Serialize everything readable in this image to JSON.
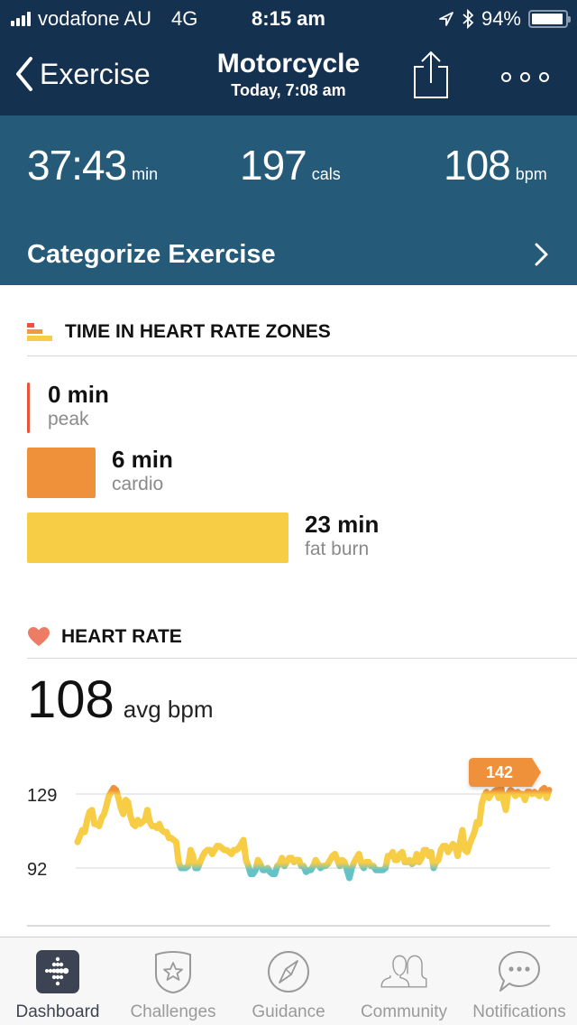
{
  "status_bar": {
    "carrier": "vodafone AU",
    "network": "4G",
    "time": "8:15 am",
    "battery_percent": "94%",
    "battery_level": 0.94,
    "icons": [
      "signal-icon",
      "location-arrow-icon",
      "bluetooth-icon",
      "battery-icon"
    ]
  },
  "nav": {
    "back_label": "Exercise",
    "title": "Motorcycle",
    "subtitle": "Today, 7:08 am",
    "share_icon": "share-icon",
    "more_icon": "more-icon"
  },
  "summary": {
    "duration": {
      "value": "37:43",
      "unit": "min"
    },
    "calories": {
      "value": "197",
      "unit": "cals"
    },
    "heart_rate": {
      "value": "108",
      "unit": "bpm"
    },
    "categorize_label": "Categorize Exercise"
  },
  "zones": {
    "title": "TIME IN HEART RATE ZONES",
    "items": [
      {
        "amount": "0 min",
        "name": "peak",
        "minutes": 0,
        "color": "#e8533a"
      },
      {
        "amount": "6 min",
        "name": "cardio",
        "minutes": 6,
        "color": "#ef913b"
      },
      {
        "amount": "23 min",
        "name": "fat burn",
        "minutes": 23,
        "color": "#f7cd45"
      }
    ]
  },
  "heart_rate": {
    "title": "HEART RATE",
    "avg_value": "108",
    "avg_unit": "avg bpm",
    "heart_color": "#ec7c64"
  },
  "chart_data": {
    "type": "line",
    "title": "HEART RATE",
    "xlabel": "",
    "ylabel": "bpm",
    "y_ticks": [
      129,
      92
    ],
    "ylim": [
      70,
      150
    ],
    "grid": true,
    "max_marker": {
      "label": "142",
      "value": 142,
      "color": "#ef913b"
    },
    "zone_colors": {
      "below_zone": "#64c3c8",
      "fat_burn": "#f7cd45",
      "cardio": "#ef913b"
    },
    "series": [
      {
        "name": "heart rate",
        "values": [
          105,
          108,
          111,
          110,
          116,
          120,
          121,
          114,
          114,
          113,
          117,
          119,
          123,
          128,
          130,
          132,
          131,
          127,
          122,
          119,
          126,
          125,
          118,
          114,
          113,
          116,
          114,
          115,
          116,
          121,
          115,
          113,
          113,
          112,
          114,
          111,
          110,
          110,
          107,
          107,
          106,
          105,
          95,
          92,
          92,
          92,
          93,
          101,
          98,
          92,
          92,
          95,
          98,
          100,
          101,
          101,
          99,
          101,
          103,
          103,
          102,
          101,
          101,
          100,
          99,
          101,
          101,
          102,
          104,
          106,
          96,
          93,
          89,
          89,
          91,
          96,
          94,
          91,
          91,
          92,
          90,
          89,
          89,
          93,
          94,
          97,
          93,
          95,
          97,
          97,
          95,
          96,
          96,
          93,
          93,
          90,
          91,
          91,
          93,
          96,
          94,
          92,
          93,
          93,
          94,
          96,
          98,
          99,
          96,
          93,
          96,
          95,
          91,
          87,
          92,
          95,
          97,
          99,
          94,
          92,
          95,
          95,
          93,
          93,
          91,
          91,
          91,
          91,
          92,
          98,
          98,
          100,
          96,
          96,
          99,
          100,
          95,
          95,
          96,
          94,
          95,
          99,
          95,
          97,
          101,
          101,
          98,
          100,
          92,
          95,
          96,
          101,
          103,
          103,
          100,
          102,
          104,
          103,
          98,
          105,
          111,
          101,
          100,
          104,
          107,
          110,
          115,
          114,
          124,
          128,
          130,
          127,
          129,
          130,
          131,
          127,
          133,
          126,
          121,
          129,
          131,
          130,
          128,
          130,
          129,
          129,
          126,
          130,
          130,
          129,
          130,
          129,
          128,
          131,
          132,
          127,
          131
        ]
      }
    ]
  },
  "tab_bar": {
    "items": [
      {
        "label": "Dashboard",
        "icon": "dashboard-icon",
        "active": true
      },
      {
        "label": "Challenges",
        "icon": "challenges-icon",
        "active": false
      },
      {
        "label": "Guidance",
        "icon": "compass-icon",
        "active": false
      },
      {
        "label": "Community",
        "icon": "community-icon",
        "active": false
      },
      {
        "label": "Notifications",
        "icon": "notifications-icon",
        "active": false
      }
    ]
  }
}
